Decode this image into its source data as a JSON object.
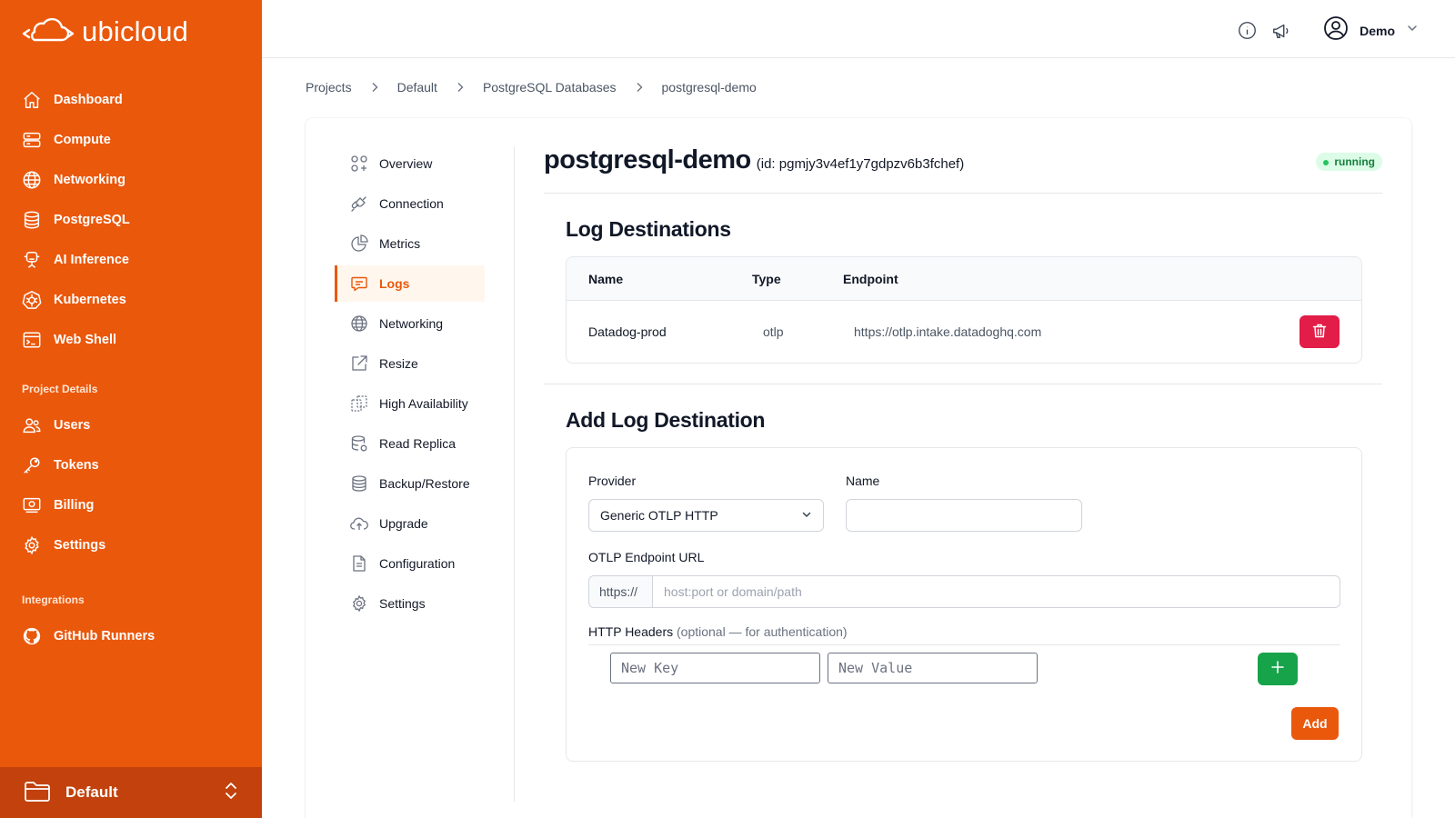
{
  "brand": {
    "name": "ubicloud"
  },
  "sidebar": {
    "items": [
      {
        "label": "Dashboard",
        "icon": "home-icon"
      },
      {
        "label": "Compute",
        "icon": "server-icon"
      },
      {
        "label": "Networking",
        "icon": "globe-icon"
      },
      {
        "label": "PostgreSQL",
        "icon": "database-icon"
      },
      {
        "label": "AI Inference",
        "icon": "ai-chip-icon"
      },
      {
        "label": "Kubernetes",
        "icon": "kubernetes-icon"
      },
      {
        "label": "Web Shell",
        "icon": "terminal-icon"
      }
    ],
    "project_section_title": "Project Details",
    "project_items": [
      {
        "label": "Users",
        "icon": "users-icon"
      },
      {
        "label": "Tokens",
        "icon": "key-icon"
      },
      {
        "label": "Billing",
        "icon": "billing-icon"
      },
      {
        "label": "Settings",
        "icon": "gear-icon"
      }
    ],
    "integrations_section_title": "Integrations",
    "integration_items": [
      {
        "label": "GitHub Runners",
        "icon": "github-icon"
      }
    ],
    "current_project": "Default"
  },
  "topbar": {
    "user_name": "Demo"
  },
  "breadcrumb": [
    "Projects",
    "Default",
    "PostgreSQL Databases",
    "postgresql-demo"
  ],
  "subnav": {
    "items": [
      {
        "label": "Overview",
        "icon": "overview-icon"
      },
      {
        "label": "Connection",
        "icon": "plug-icon"
      },
      {
        "label": "Metrics",
        "icon": "pie-chart-icon"
      },
      {
        "label": "Logs",
        "icon": "chat-icon"
      },
      {
        "label": "Networking",
        "icon": "globe-icon"
      },
      {
        "label": "Resize",
        "icon": "resize-icon"
      },
      {
        "label": "High Availability",
        "icon": "high-availability-icon"
      },
      {
        "label": "Read Replica",
        "icon": "read-replica-icon"
      },
      {
        "label": "Backup/Restore",
        "icon": "database-icon"
      },
      {
        "label": "Upgrade",
        "icon": "cloud-upload-icon"
      },
      {
        "label": "Configuration",
        "icon": "document-icon"
      },
      {
        "label": "Settings",
        "icon": "gear-icon"
      }
    ],
    "active": "Logs"
  },
  "resource": {
    "name": "postgresql-demo",
    "id_text": "(id: pgmjy3v4ef1y7gdpzv6b3fchef)",
    "status": "running"
  },
  "log_destinations": {
    "title": "Log Destinations",
    "columns": [
      "Name",
      "Type",
      "Endpoint"
    ],
    "rows": [
      {
        "name": "Datadog-prod",
        "type": "otlp",
        "endpoint": "https://otlp.intake.datadoghq.com"
      }
    ]
  },
  "add_form": {
    "title": "Add Log Destination",
    "provider_label": "Provider",
    "provider_value": "Generic OTLP HTTP",
    "name_label": "Name",
    "name_value": "",
    "endpoint_label": "OTLP Endpoint URL",
    "endpoint_prefix": "https://",
    "endpoint_placeholder": "host:port or domain/path",
    "headers_label": "HTTP Headers",
    "headers_optional": "(optional — for authentication)",
    "key_placeholder": "New Key",
    "value_placeholder": "New Value",
    "submit_label": "Add"
  },
  "colors": {
    "brand": "#ea580c",
    "danger": "#e11d48",
    "success": "#16a34a",
    "status_bg": "#dcfce7"
  }
}
